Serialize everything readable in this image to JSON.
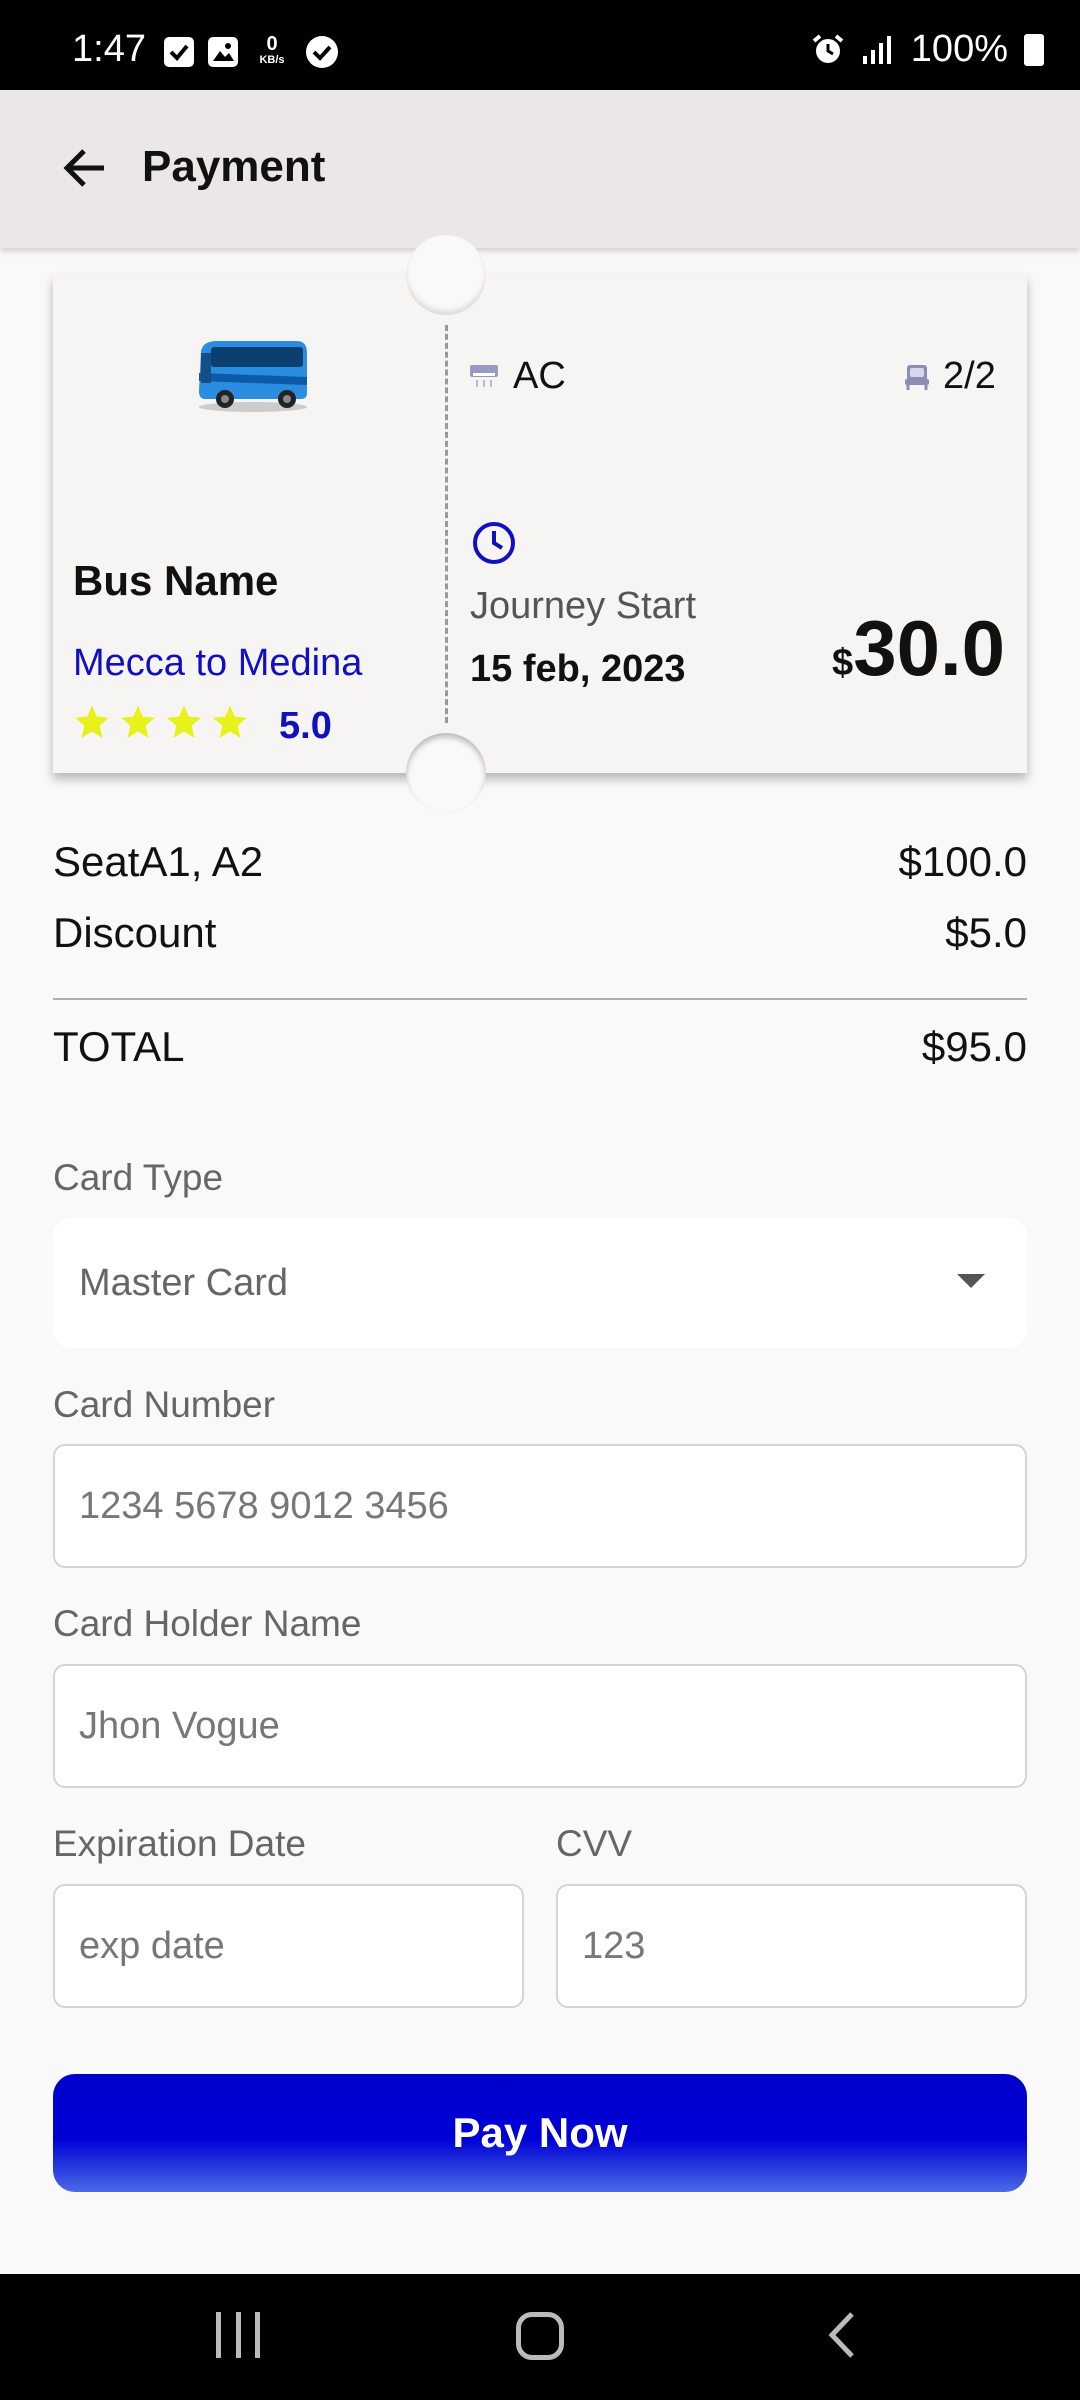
{
  "status_bar": {
    "time": "1:47",
    "net_speed_value": "0",
    "net_speed_unit": "KB/s",
    "battery": "100%",
    "icons": [
      "checkbox-icon",
      "image-icon",
      "check-circle-icon",
      "alarm-icon",
      "signal-icon",
      "battery-icon"
    ]
  },
  "app_bar": {
    "title": "Payment",
    "back_icon": "arrow-left-icon"
  },
  "ticket": {
    "bus_name": "Bus Name",
    "route": "Mecca to Medina",
    "stars": 4,
    "rating": "5.0",
    "amenity": "AC",
    "seats": "2/2",
    "journey_label": "Journey Start",
    "journey_date": "15 feb, 2023",
    "currency": "$",
    "price": "30.0"
  },
  "summary": {
    "seat_label": "SeatA1, A2",
    "seat_amount": "$100.0",
    "discount_label": "Discount",
    "discount_amount": "$5.0",
    "total_label": "TOTAL",
    "total_amount": "$95.0"
  },
  "form": {
    "card_type_label": "Card Type",
    "card_type_value": "Master Card",
    "card_number_label": "Card Number",
    "card_number_placeholder": "1234 5678 9012 3456",
    "holder_label": "Card Holder Name",
    "holder_placeholder": "Jhon Vogue",
    "exp_label": "Expiration Date",
    "exp_placeholder": "exp date",
    "cvv_label": "CVV",
    "cvv_placeholder": "123",
    "pay_button": "Pay Now"
  },
  "colors": {
    "accent": "#0000CC",
    "route_text": "#1010C0",
    "star": "#E6F21A"
  }
}
